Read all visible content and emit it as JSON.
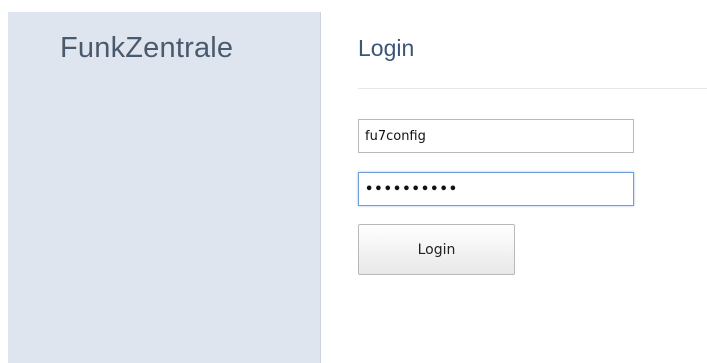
{
  "sidebar": {
    "brand": "FunkZentrale"
  },
  "main": {
    "heading": "Login"
  },
  "form": {
    "username_value": "fu7config",
    "password_value": "••••••••••",
    "submit_label": "Login"
  }
}
